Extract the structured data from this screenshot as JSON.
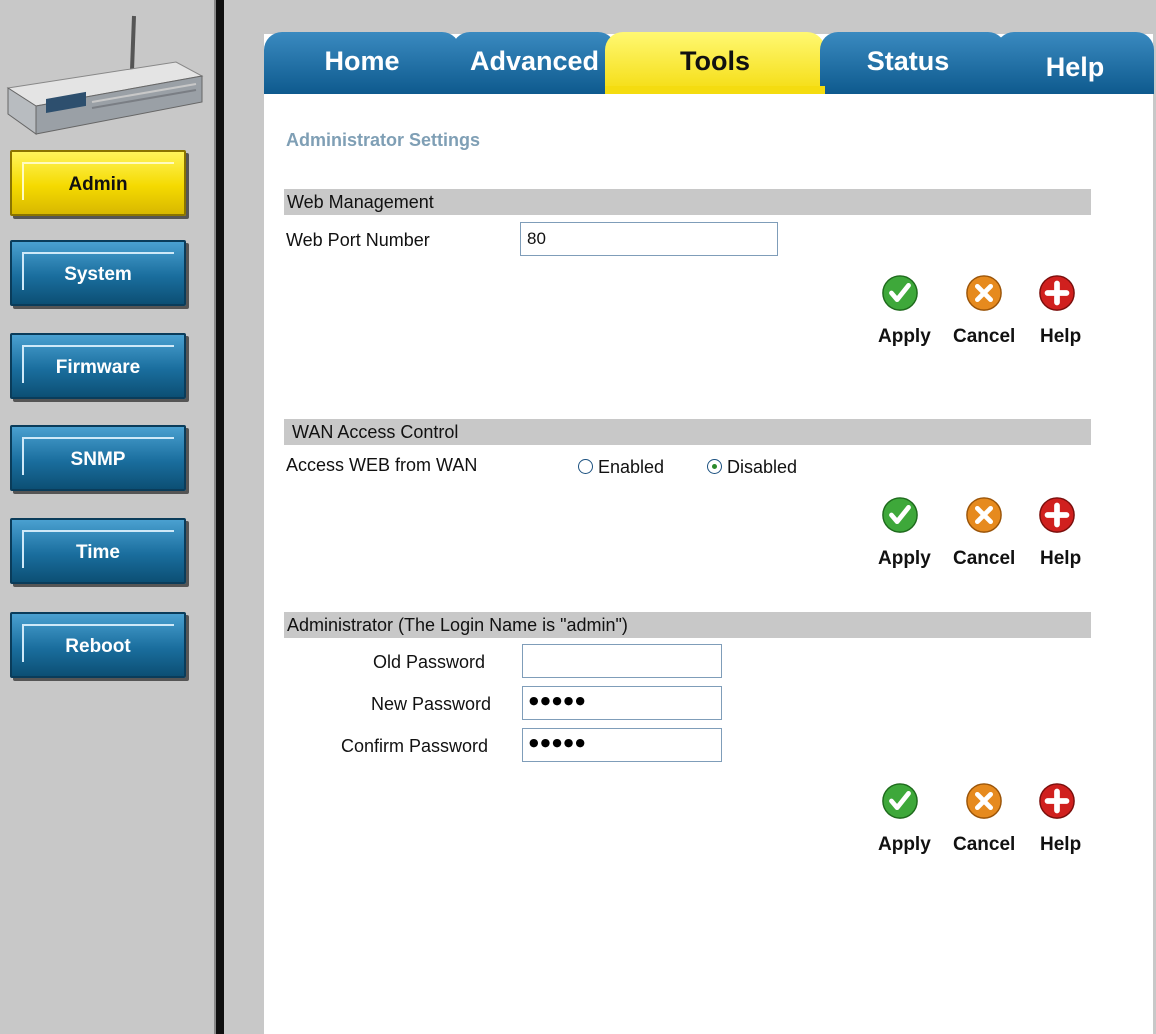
{
  "sidebar": {
    "items": [
      {
        "label": "Admin",
        "active": true
      },
      {
        "label": "System",
        "active": false
      },
      {
        "label": "Firmware",
        "active": false
      },
      {
        "label": "SNMP",
        "active": false
      },
      {
        "label": "Time",
        "active": false
      },
      {
        "label": "Reboot",
        "active": false
      }
    ]
  },
  "tabs": [
    {
      "label": "Home",
      "active": false
    },
    {
      "label": "Advanced",
      "active": false
    },
    {
      "label": "Tools",
      "active": true
    },
    {
      "label": "Status",
      "active": false
    },
    {
      "label": "Help",
      "active": false
    }
  ],
  "page": {
    "title": "Administrator Settings"
  },
  "web_management": {
    "heading": "Web Management",
    "port_label": "Web Port Number",
    "port_value": "80"
  },
  "wan_access": {
    "heading": "WAN Access Control",
    "label": "Access WEB from WAN",
    "options": [
      {
        "label": "Enabled",
        "selected": false
      },
      {
        "label": "Disabled",
        "selected": true
      }
    ]
  },
  "administrator": {
    "heading": "Administrator (The Login Name is \"admin\")",
    "old_password_label": "Old Password",
    "new_password_label": "New Password",
    "confirm_password_label": "Confirm Password",
    "new_password_mask": "●●●●●",
    "confirm_password_mask": "●●●●●"
  },
  "actions": {
    "apply": "Apply",
    "cancel": "Cancel",
    "help": "Help"
  },
  "colors": {
    "tab_blue": "#0e5a8e",
    "tab_active": "#f4dc10",
    "apply_green": "#3ea83a",
    "cancel_orange": "#e68a1e",
    "help_red": "#d0201e",
    "title_blue": "#7f9fb5"
  }
}
